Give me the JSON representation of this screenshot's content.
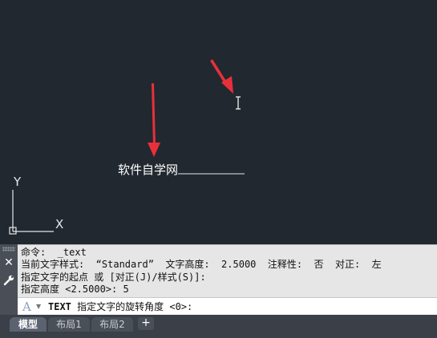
{
  "canvas": {
    "text_object": "软件自学网",
    "ucs_x_label": "X",
    "ucs_y_label": "Y",
    "arrow_color": "#e8303a",
    "background": "#212830"
  },
  "command_history": [
    "命令:  _text",
    "当前文字样式:  “Standard”  文字高度:  2.5000  注释性:  否  对正:  左",
    "指定文字的起点 或 [对正(J)/样式(S)]:",
    "指定高度 <2.5000>: 5"
  ],
  "command_input": {
    "command": "TEXT",
    "prompt": " 指定文字的旋转角度 <0>:",
    "icon": "text-style-icon"
  },
  "sidebar": {
    "close_glyph": "✕",
    "customize_glyph": "🔧"
  },
  "tabs": [
    {
      "label": "模型",
      "active": true
    },
    {
      "label": "布局1",
      "active": false
    },
    {
      "label": "布局2",
      "active": false
    }
  ],
  "add_tab_label": "+"
}
